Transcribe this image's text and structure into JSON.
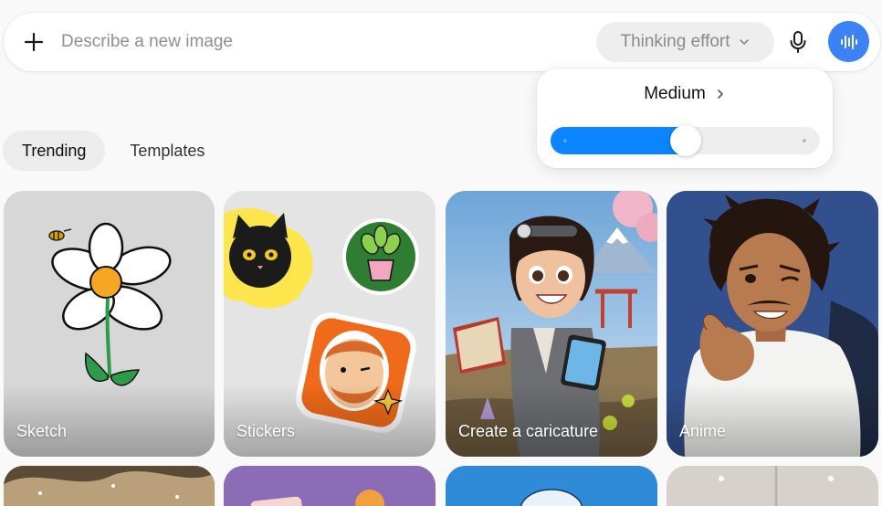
{
  "prompt": {
    "placeholder": "Describe a new image",
    "add_icon": "plus-icon",
    "mic_icon": "microphone-icon",
    "voice_icon": "voice-waveform-icon"
  },
  "thinking_effort": {
    "label": "Thinking effort",
    "chevron_icon": "chevron-down-icon",
    "selected_level": "Medium",
    "level_chevron_icon": "chevron-right-icon",
    "slider_value": 0.5
  },
  "tabs": [
    {
      "label": "Trending",
      "active": true
    },
    {
      "label": "Templates",
      "active": false
    }
  ],
  "cards": [
    {
      "label": "Sketch"
    },
    {
      "label": "Stickers"
    },
    {
      "label": "Create a caricature"
    },
    {
      "label": "Anime"
    }
  ],
  "colors": {
    "accent_blue": "#3b82f6",
    "slider_blue": "#0a84ff",
    "background": "#f9f9f9"
  }
}
